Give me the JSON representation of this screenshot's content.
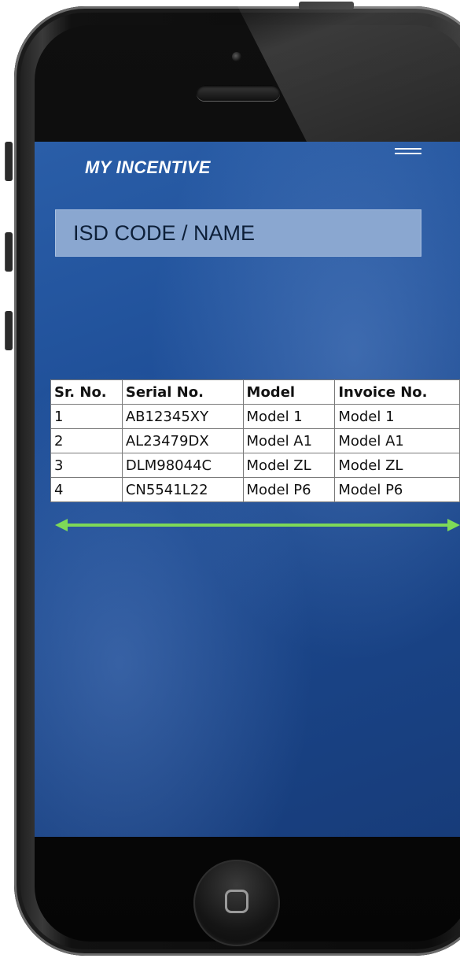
{
  "app": {
    "title": "MY INCENTIVE"
  },
  "search": {
    "placeholder": "ISD CODE / NAME",
    "value": ""
  },
  "table": {
    "headers": [
      "Sr. No.",
      "Serial No.",
      "Model",
      "Invoice No."
    ],
    "rows": [
      [
        "1",
        "AB12345XY",
        "Model 1",
        "Model 1"
      ],
      [
        "2",
        "AL23479DX",
        "Model A1",
        "Model A1"
      ],
      [
        "3",
        "DLM98044C",
        "Model ZL",
        "Model ZL"
      ],
      [
        "4",
        "CN5541L22",
        "Model P6",
        "Model P6"
      ]
    ]
  },
  "colors": {
    "screen_background": "#1f4f98",
    "search_field": "#8aa7d0",
    "scroll_arrow": "#7ed957",
    "phone_body": "#111111"
  },
  "icons": {
    "menu": "hamburger-menu-icon",
    "scroll": "double-headed-arrow-icon",
    "home": "home-button-square-icon"
  }
}
